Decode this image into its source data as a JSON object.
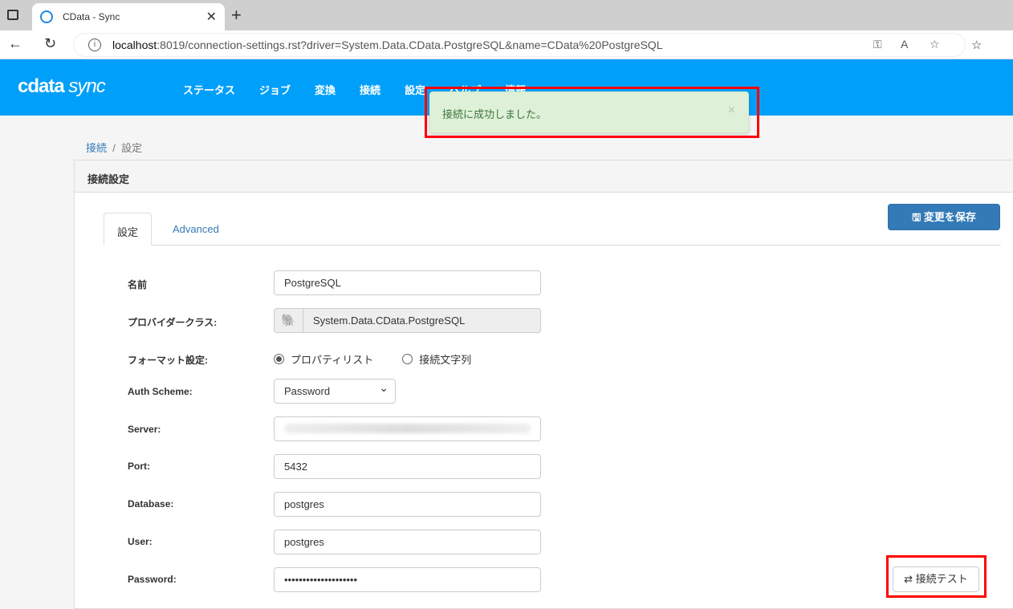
{
  "browser": {
    "tab_title": "CData - Sync",
    "url_host": "localhost",
    "url_rest": ":8019/connection-settings.rst?driver=System.Data.CData.PostgreSQL&name=CData%20PostgreSQL"
  },
  "app": {
    "logo": "cdata",
    "logo_sub": "sync",
    "menu": [
      "ステータス",
      "ジョブ",
      "変換",
      "接続",
      "設定",
      "ヘルプ",
      "情報"
    ]
  },
  "alert": {
    "message": "接続に成功しました。",
    "close": "×"
  },
  "breadcrumb": {
    "parent": "接続",
    "current": "設定",
    "sep": "/"
  },
  "panel": {
    "title": "接続設定",
    "tabs": [
      "設定",
      "Advanced"
    ],
    "save": "変更を保存",
    "test": "接続テスト"
  },
  "form": {
    "name_label": "名前",
    "name_value": "PostgreSQL",
    "provider_label": "プロバイダークラス:",
    "provider_value": "System.Data.CData.PostgreSQL",
    "format_label": "フォーマット設定:",
    "format_options": [
      "プロパティリスト",
      "接続文字列"
    ],
    "auth_label": "Auth Scheme:",
    "auth_value": "Password",
    "server_label": "Server:",
    "port_label": "Port:",
    "port_value": "5432",
    "database_label": "Database:",
    "database_value": "postgres",
    "user_label": "User:",
    "user_value": "postgres",
    "password_label": "Password:",
    "password_value": "••••••••••••••••••••"
  }
}
